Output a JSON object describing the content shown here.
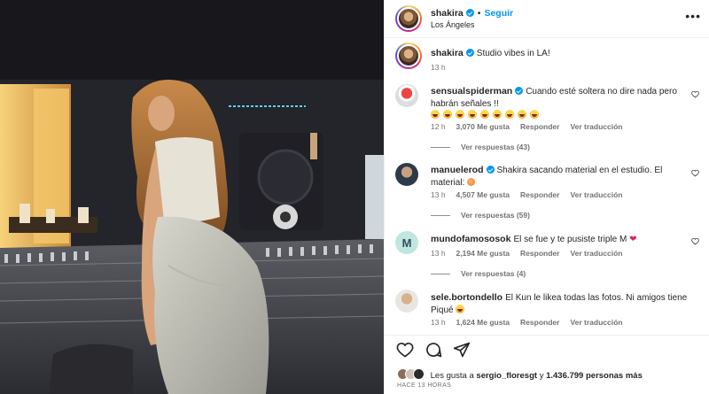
{
  "post": {
    "author": "shakira",
    "follow_label": "Seguir",
    "location": "Los Ángeles",
    "caption_author": "shakira",
    "caption": "Studio vibes in LA!",
    "caption_time": "13 h"
  },
  "comments": [
    {
      "username": "sensualspiderman",
      "verified": true,
      "line1": "Cuando esté soltera no dire nada pero",
      "line2": "habrán señales !!",
      "emoji_count": 9,
      "time": "12 h",
      "likes": "3,070 Me gusta",
      "reply": "Responder",
      "translate": "Ver traducción",
      "view_replies": "Ver respuestas (43)"
    },
    {
      "username": "manuelerod",
      "verified": true,
      "line1": "Shakira sacando material en el estudio. El",
      "line2": "material:",
      "time": "13 h",
      "likes": "4,507 Me gusta",
      "reply": "Responder",
      "translate": "Ver traducción",
      "view_replies": "Ver respuestas (59)"
    },
    {
      "username": "mundofamososok",
      "verified": false,
      "line1": "El se fue y te pusiste triple M",
      "time": "13 h",
      "likes": "2,194 Me gusta",
      "reply": "Responder",
      "translate": "Ver traducción",
      "view_replies": "Ver respuestas (4)"
    },
    {
      "username": "sele.bortondello",
      "verified": false,
      "line1": "El Kun le likea todas las fotos. Ni amigos tiene",
      "line2": "Piqué",
      "time": "13 h",
      "likes": "1,624 Me gusta",
      "reply": "Responder",
      "translate": "Ver traducción"
    }
  ],
  "footer": {
    "likes_prefix": "Les gusta a",
    "likes_user": "sergio_floresgt",
    "likes_middle": "y",
    "likes_count": "1.436.799 personas más",
    "time_ago": "HACE 13 HORAS"
  },
  "colors": {
    "accent_blue": "#0095f6",
    "text_primary": "#262626",
    "text_secondary": "#737373"
  },
  "icons": [
    "more-icon",
    "heart-icon",
    "comment-icon",
    "share-icon",
    "verified-icon"
  ]
}
